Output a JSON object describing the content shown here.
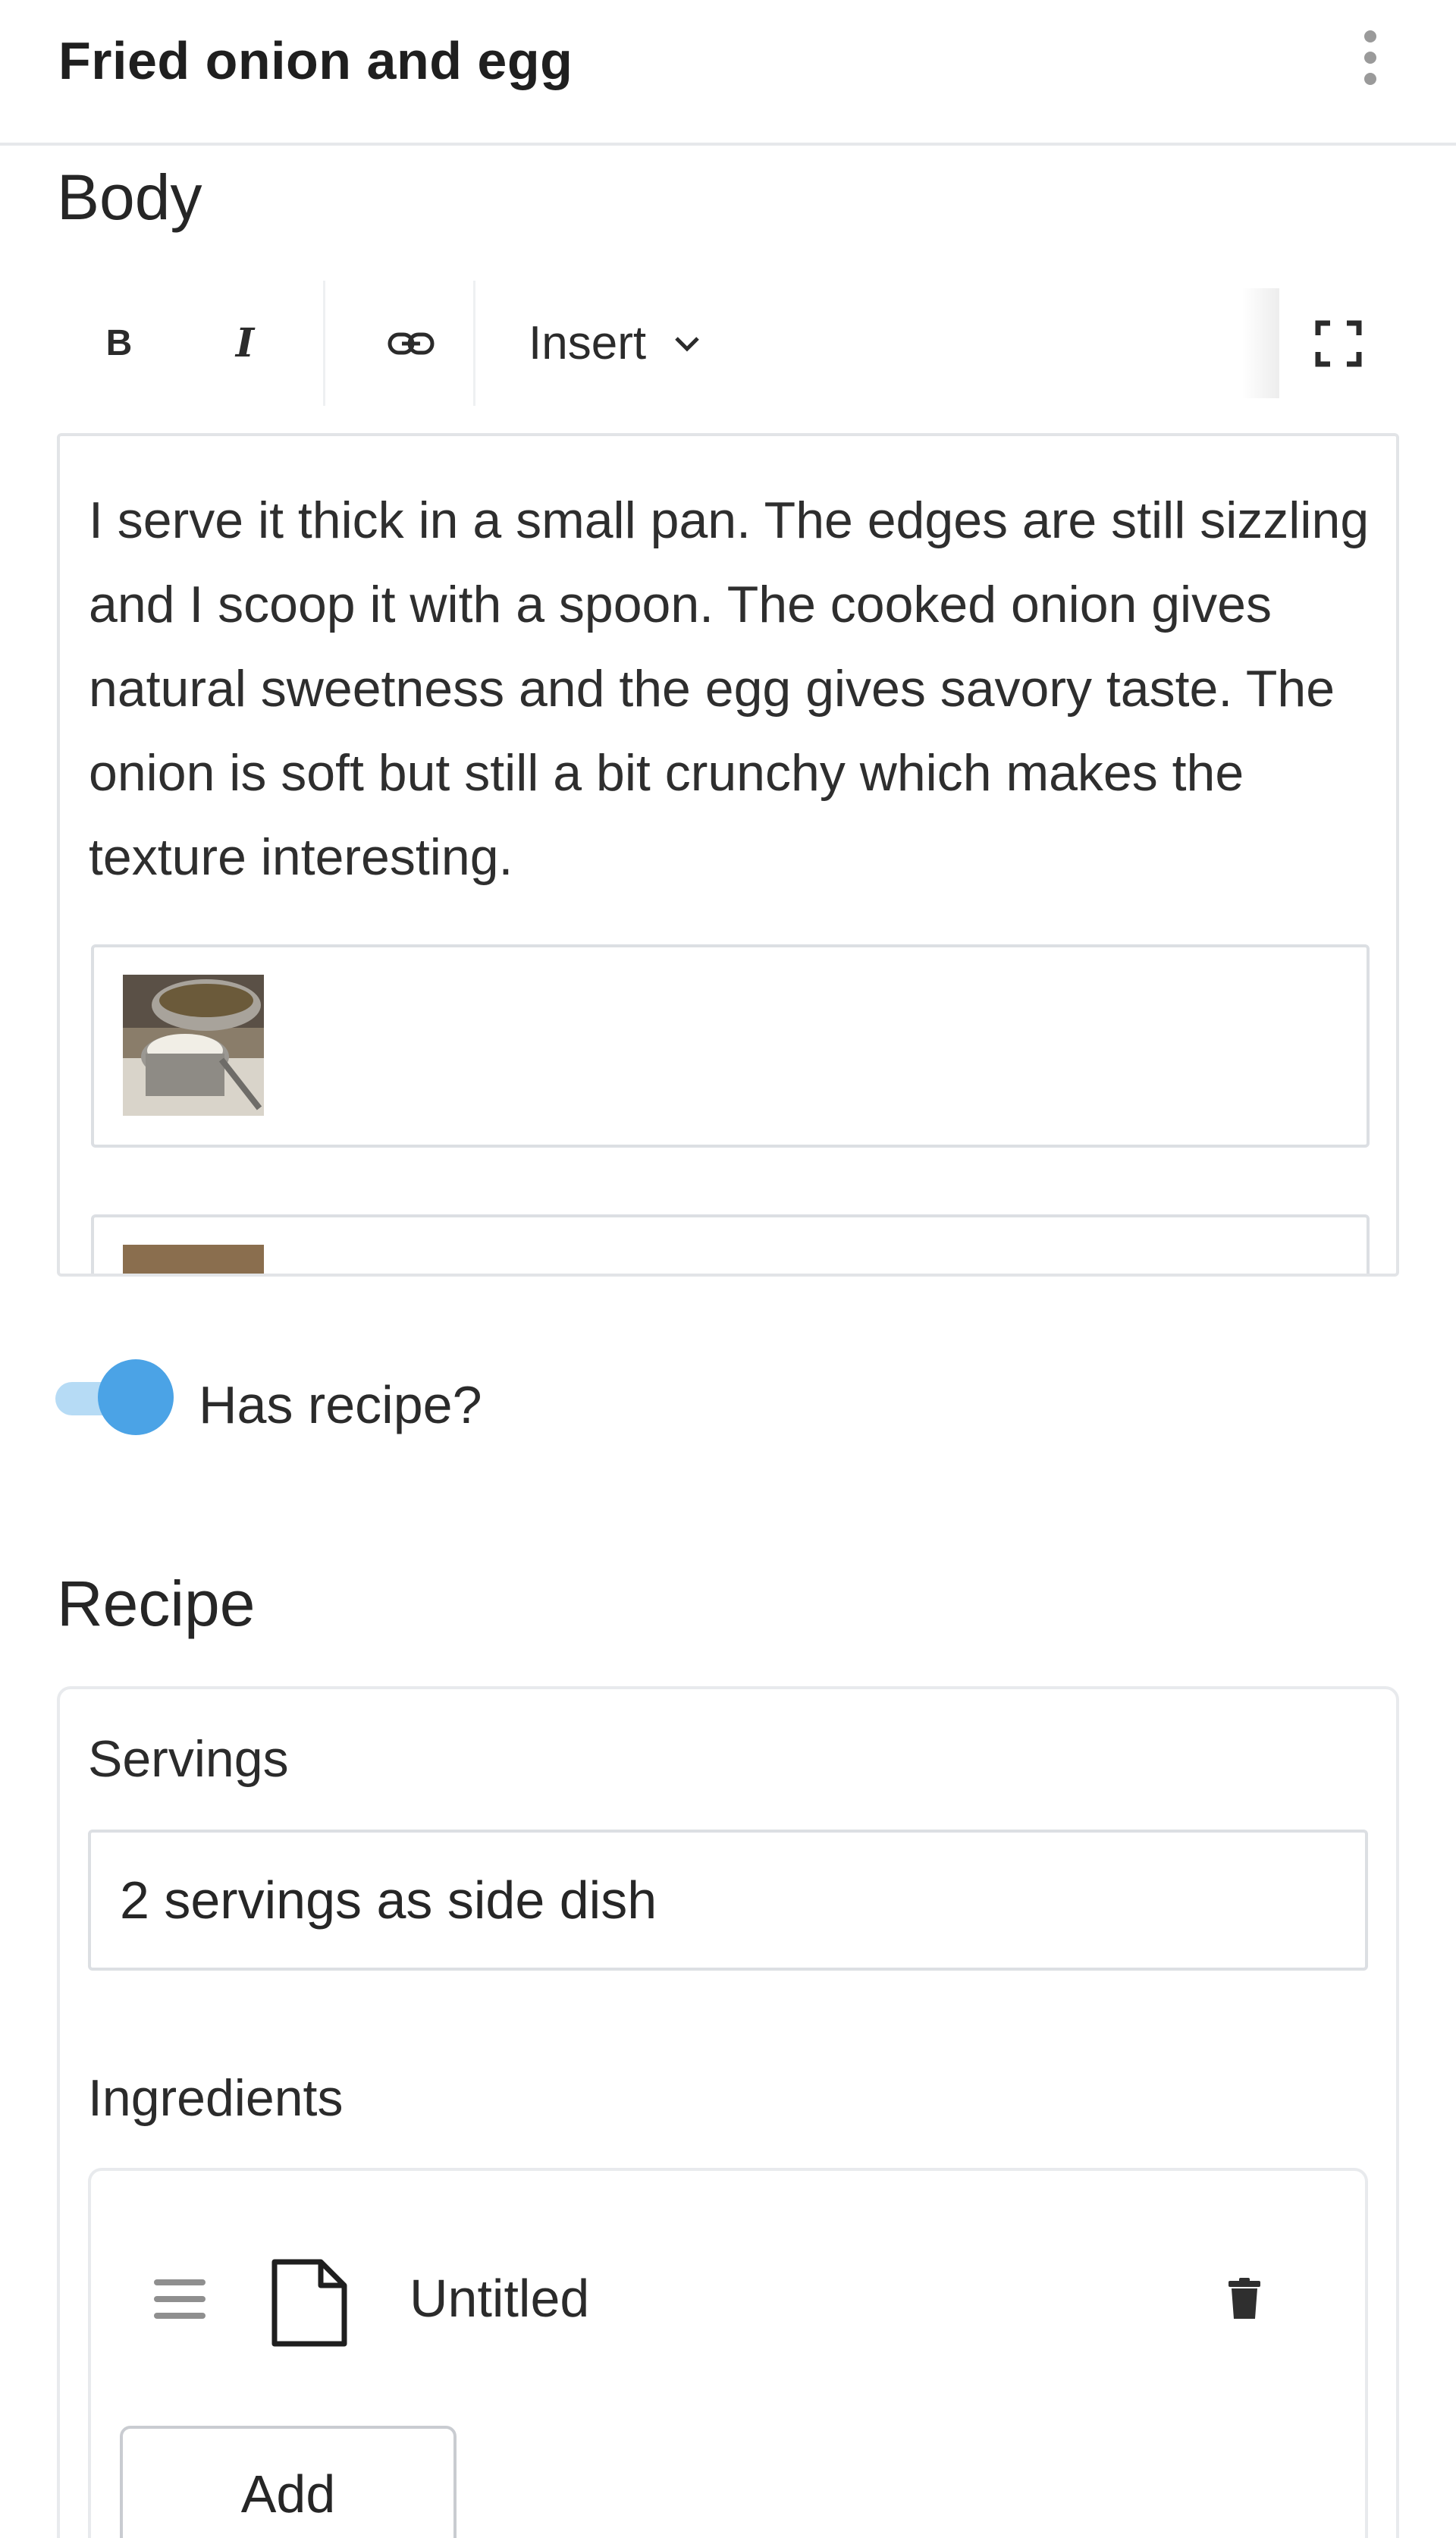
{
  "header": {
    "title": "Fried onion and egg",
    "menu_icon": "more-vertical-icon"
  },
  "body_section": {
    "label": "Body",
    "toolbar": {
      "bold_label": "B",
      "italic_label": "I",
      "link_icon": "link-icon",
      "insert_label": "Insert",
      "insert_icon": "chevron-down-icon",
      "fullscreen_icon": "fullscreen-icon"
    },
    "text": "I serve it thick in a small pan. The edges are still sizzling and I scoop it with a spoon. The cooked onion gives natural sweetness and the egg gives savory taste. The onion is soft but still a bit crunchy which makes the texture interesting.",
    "image_blocks": [
      {
        "icon": "image-thumbnail"
      },
      {
        "icon": "image-thumbnail"
      }
    ]
  },
  "has_recipe": {
    "label": "Has recipe?",
    "checked": true
  },
  "recipe": {
    "label": "Recipe",
    "servings": {
      "label": "Servings",
      "value": "2 servings as side dish"
    },
    "ingredients": {
      "label": "Ingredients",
      "items": [
        {
          "title": "Untitled",
          "icon": "document-icon",
          "drag_icon": "drag-handle-icon",
          "delete_icon": "trash-icon"
        }
      ],
      "add_label": "Add"
    }
  },
  "colors": {
    "toggle_on": "#4ba3e6",
    "toggle_track": "#b6dbf5",
    "border": "#dcdfe3"
  }
}
